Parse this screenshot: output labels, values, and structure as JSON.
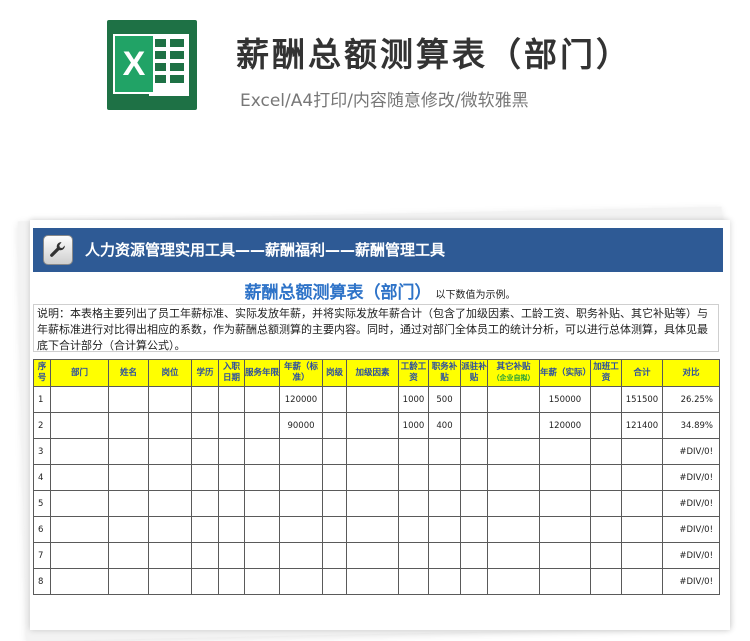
{
  "header": {
    "logo_letter": "X",
    "title": "薪酬总额测算表（部门）",
    "subtitle": "Excel/A4打印/内容随意修改/微软雅黑"
  },
  "sheet": {
    "banner_text": "人力资源管理实用工具——薪酬福利——薪酬管理工具",
    "title": "薪酬总额测算表（部门）",
    "note": "以下数值为示例。",
    "description": "说明：本表格主要列出了员工年薪标准、实际发放年薪，并将实际发放年薪合计（包含了加级因素、工龄工资、职务补贴、其它补贴等）与年薪标准进行对比得出相应的系数，作为薪酬总额测算的主要内容。同时，通过对部门全体员工的统计分析，可以进行总体测算，具体见最底下合计部分（合计算公式）。",
    "columns": [
      {
        "label": "序号"
      },
      {
        "label": "部门"
      },
      {
        "label": "姓名"
      },
      {
        "label": "岗位"
      },
      {
        "label": "学历"
      },
      {
        "label": "入职日期"
      },
      {
        "label": "服务年限"
      },
      {
        "label": "年薪（标准）"
      },
      {
        "label": "岗级"
      },
      {
        "label": "加级因素"
      },
      {
        "label": "工龄工资"
      },
      {
        "label": "职务补贴"
      },
      {
        "label": "派驻补贴"
      },
      {
        "label": "其它补贴",
        "sublabel": "（企业自拟）"
      },
      {
        "label": "年薪（实际）"
      },
      {
        "label": "加班工资"
      },
      {
        "label": "合计"
      },
      {
        "label": "对比"
      }
    ],
    "rows": [
      [
        "1",
        "",
        "",
        "",
        "",
        "",
        "",
        "120000",
        "",
        "",
        "1000",
        "500",
        "",
        "",
        "150000",
        "",
        "151500",
        "26.25%"
      ],
      [
        "2",
        "",
        "",
        "",
        "",
        "",
        "",
        "90000",
        "",
        "",
        "1000",
        "400",
        "",
        "",
        "120000",
        "",
        "121400",
        "34.89%"
      ],
      [
        "3",
        "",
        "",
        "",
        "",
        "",
        "",
        "",
        "",
        "",
        "",
        "",
        "",
        "",
        "",
        "",
        "",
        "#DIV/0!"
      ],
      [
        "4",
        "",
        "",
        "",
        "",
        "",
        "",
        "",
        "",
        "",
        "",
        "",
        "",
        "",
        "",
        "",
        "",
        "#DIV/0!"
      ],
      [
        "5",
        "",
        "",
        "",
        "",
        "",
        "",
        "",
        "",
        "",
        "",
        "",
        "",
        "",
        "",
        "",
        "",
        "#DIV/0!"
      ],
      [
        "6",
        "",
        "",
        "",
        "",
        "",
        "",
        "",
        "",
        "",
        "",
        "",
        "",
        "",
        "",
        "",
        "",
        "#DIV/0!"
      ],
      [
        "7",
        "",
        "",
        "",
        "",
        "",
        "",
        "",
        "",
        "",
        "",
        "",
        "",
        "",
        "",
        "",
        "",
        "#DIV/0!"
      ],
      [
        "8",
        "",
        "",
        "",
        "",
        "",
        "",
        "",
        "",
        "",
        "",
        "",
        "",
        "",
        "",
        "",
        "",
        "#DIV/0!"
      ]
    ]
  },
  "colors": {
    "banner": "#2e5a95",
    "header_fill": "#ffff00",
    "header_text": "#2b4ea0",
    "title_text": "#2e73c8",
    "excel_green": "#1e7145"
  }
}
